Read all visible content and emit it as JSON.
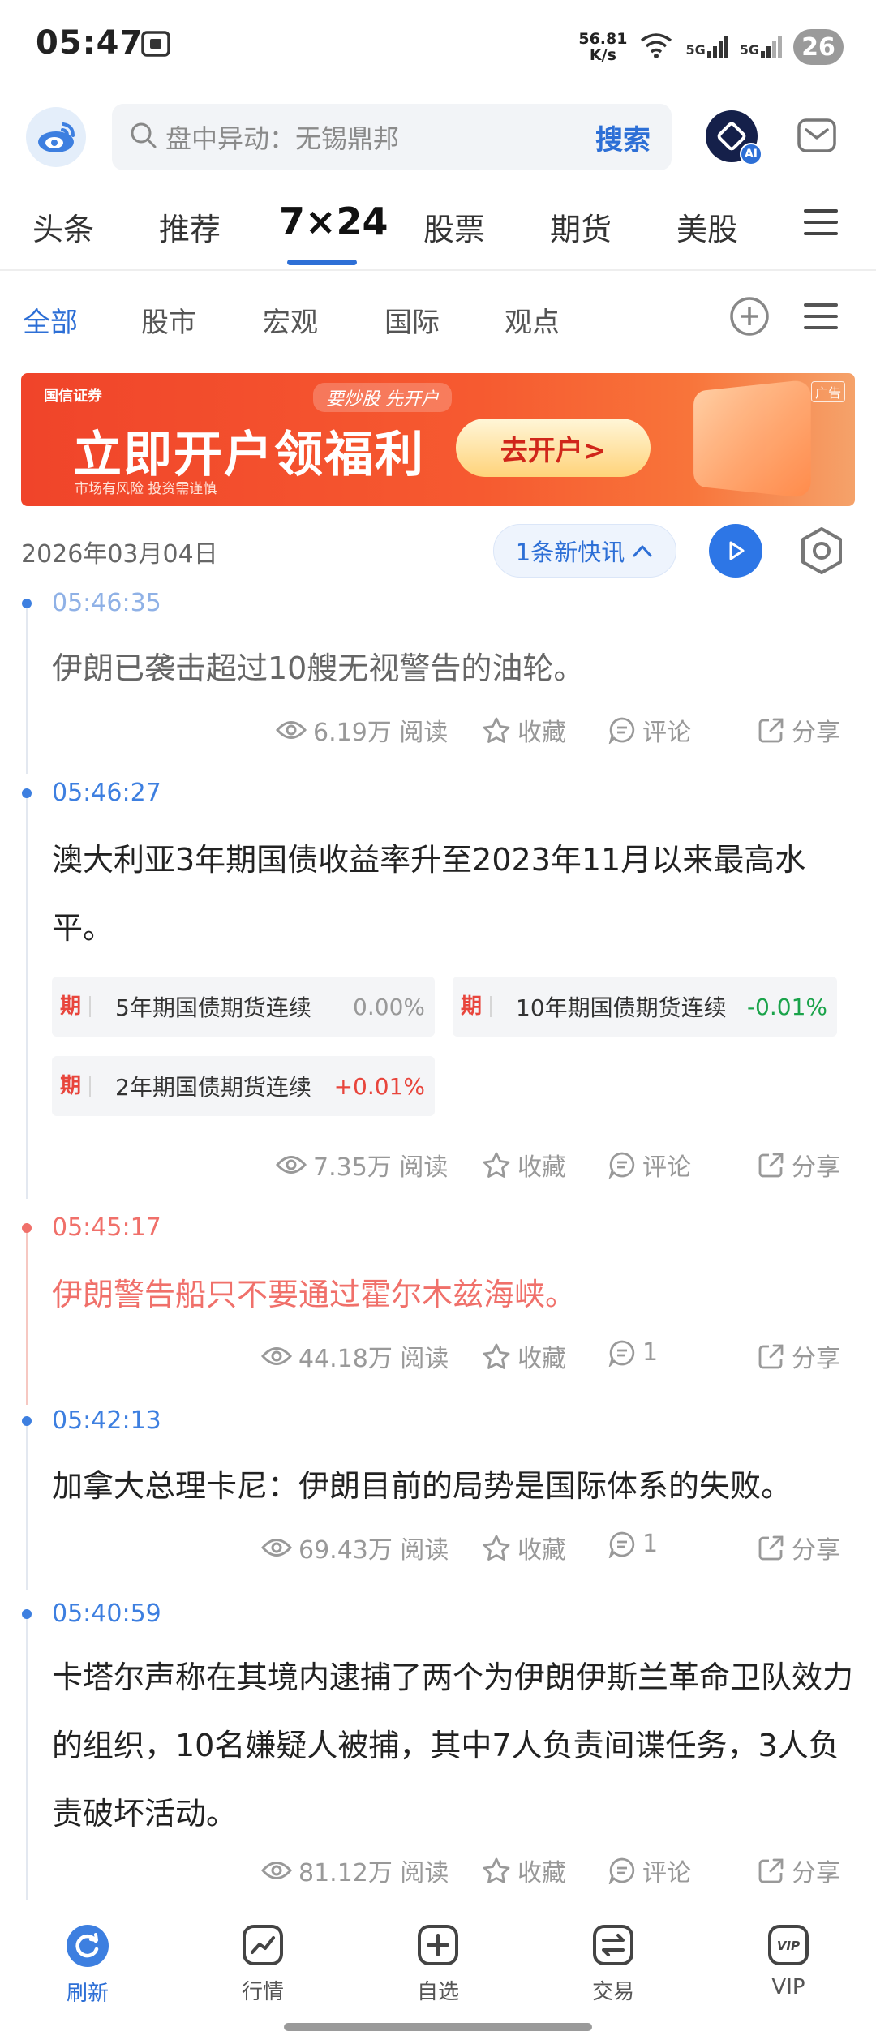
{
  "status_bar": {
    "time": "05:47",
    "net_speed_value": "56.81",
    "net_speed_unit": "K/s",
    "signal_1": "5G",
    "signal_2": "5G",
    "battery": "26"
  },
  "header": {
    "search_placeholder": "盘中异动：无锡鼎邦",
    "search_button": "搜索",
    "ai_badge": "AI"
  },
  "main_tabs": [
    "头条",
    "推荐",
    "7×24",
    "股票",
    "期货",
    "美股"
  ],
  "sub_tabs": [
    "全部",
    "股市",
    "宏观",
    "国际",
    "观点"
  ],
  "banner": {
    "brand": "国信证券",
    "slogan": "要炒股 先开户",
    "headline": "立即开户领福利",
    "disclaimer": "市场有风险  投资需谨慎",
    "cta": "去开户>",
    "ad_tag": "广告"
  },
  "feed": {
    "date": "2026年03月04日",
    "new_count": "1条新快讯",
    "items": [
      {
        "time": "05:46:35",
        "text": "伊朗已袭击超过10艘无视警告的油轮。",
        "reads": "6.19万 阅读",
        "fav": "收藏",
        "comments": "评论",
        "share": "分享"
      },
      {
        "time": "05:46:27",
        "text": "澳大利亚3年期国债收益率升至2023年11月以来最高水平。",
        "chips": [
          {
            "tag": "期",
            "name": "5年期国债期货连续",
            "value": "0.00%"
          },
          {
            "tag": "期",
            "name": "10年期国债期货连续",
            "value": "-0.01%"
          },
          {
            "tag": "期",
            "name": "2年期国债期货连续",
            "value": "+0.01%"
          }
        ],
        "reads": "7.35万 阅读",
        "fav": "收藏",
        "comments": "评论",
        "share": "分享"
      },
      {
        "time": "05:45:17",
        "text": "伊朗警告船只不要通过霍尔木兹海峡。",
        "reads": "44.18万 阅读",
        "fav": "收藏",
        "comments": "1",
        "share": "分享"
      },
      {
        "time": "05:42:13",
        "text": "加拿大总理卡尼：伊朗目前的局势是国际体系的失败。",
        "reads": "69.43万 阅读",
        "fav": "收藏",
        "comments": "1",
        "share": "分享"
      },
      {
        "time": "05:40:59",
        "text": "卡塔尔声称在其境内逮捕了两个为伊朗伊斯兰革命卫队效力的组织，10名嫌疑人被捕，其中7人负责间谍任务，3人负责破坏活动。",
        "reads": "81.12万 阅读",
        "fav": "收藏",
        "comments": "评论",
        "share": "分享"
      }
    ]
  },
  "bottom_nav": [
    "刷新",
    "行情",
    "自选",
    "交易",
    "VIP"
  ],
  "colors": {
    "accent": "#2d6fd6",
    "highlight_red": "#f0706a",
    "up_red": "#e8453c",
    "down_green": "#1aa34a"
  }
}
